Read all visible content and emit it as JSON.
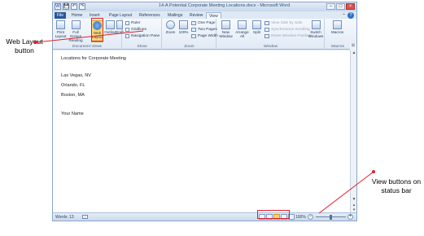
{
  "window": {
    "title": "14-A Potential Corporate Meeting Locations.docx - Microsoft Word",
    "controls": [
      "–",
      "□",
      "×"
    ]
  },
  "quick_access": [
    "W",
    "💾",
    "↶",
    "↷"
  ],
  "tabs": [
    {
      "label": "File",
      "state": "file"
    },
    {
      "label": "Home",
      "state": "normal"
    },
    {
      "label": "Insert",
      "state": "normal"
    },
    {
      "label": "Page Layout",
      "state": "normal"
    },
    {
      "label": "References",
      "state": "normal"
    },
    {
      "label": "Mailings",
      "state": "normal"
    },
    {
      "label": "Review",
      "state": "normal"
    },
    {
      "label": "View",
      "state": "active"
    }
  ],
  "ribbon": {
    "document_views": {
      "label": "Document Views",
      "buttons": [
        "Print Layout",
        "Full Screen Reading",
        "Web Layout",
        "Outline",
        "Draft"
      ],
      "selected": "Web Layout"
    },
    "show": {
      "label": "Show",
      "items": [
        "Ruler",
        "Gridlines",
        "Navigation Pane"
      ]
    },
    "zoom": {
      "label": "Zoom",
      "buttons": [
        "Zoom",
        "100%"
      ],
      "small": [
        "One Page",
        "Two Pages",
        "Page Width"
      ]
    },
    "window": {
      "label": "Window",
      "buttons": [
        "New Window",
        "Arrange All",
        "Split"
      ],
      "small": [
        "View Side by Side",
        "Synchronous Scrolling",
        "Reset Window Position"
      ],
      "switch": "Switch Windows"
    },
    "macros": {
      "label": "Macros",
      "button": "Macros"
    }
  },
  "document": {
    "lines": [
      "Locations for Corporate Meeting",
      "Las Vegas, NV",
      "Orlando, FL",
      "Boston, MA",
      "Your Name"
    ]
  },
  "statusbar": {
    "words": "Words: 13",
    "zoom": "100%"
  },
  "callouts": {
    "left": "Web Layout button",
    "right": "View buttons on status bar"
  },
  "colors": {
    "highlight": "#e0202a",
    "selected_button": "#fbd879",
    "file_tab": "#2b5797"
  }
}
